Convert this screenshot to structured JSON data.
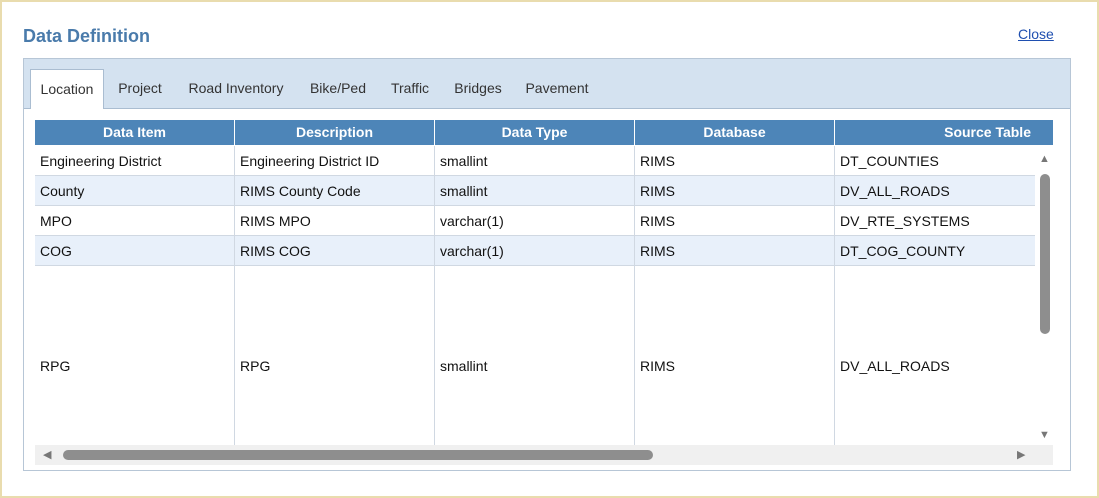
{
  "dialog": {
    "title": "Data Definition",
    "close_label": "Close"
  },
  "tabs": [
    {
      "label": "Location",
      "active": true
    },
    {
      "label": "Project"
    },
    {
      "label": "Road Inventory"
    },
    {
      "label": "Bike/Ped"
    },
    {
      "label": "Traffic"
    },
    {
      "label": "Bridges"
    },
    {
      "label": "Pavement"
    }
  ],
  "table": {
    "columns": [
      "Data Item",
      "Description",
      "Data Type",
      "Database",
      "Source Table"
    ],
    "rows": [
      [
        "Engineering District",
        "Engineering District ID",
        "smallint",
        "RIMS",
        "DT_COUNTIES"
      ],
      [
        "County",
        "RIMS County Code",
        "smallint",
        "RIMS",
        "DV_ALL_ROADS"
      ],
      [
        "MPO",
        "RIMS MPO",
        "varchar(1)",
        "RIMS",
        "DV_RTE_SYSTEMS"
      ],
      [
        "COG",
        "RIMS COG",
        "varchar(1)",
        "RIMS",
        "DT_COG_COUNTY"
      ],
      [
        "RPG",
        "RPG",
        "smallint",
        "RIMS",
        "DV_ALL_ROADS"
      ]
    ]
  },
  "icons": {
    "scroll_up": "triangle-up-icon",
    "scroll_down": "triangle-down-icon",
    "scroll_left": "triangle-left-icon",
    "scroll_right": "triangle-right-icon"
  },
  "colors": {
    "title": "#4a7bab",
    "header_bg": "#4d85b8",
    "tabbar_bg": "#d4e2f0",
    "alt_row": "#e8f0fa",
    "frame": "#e9dcae"
  }
}
